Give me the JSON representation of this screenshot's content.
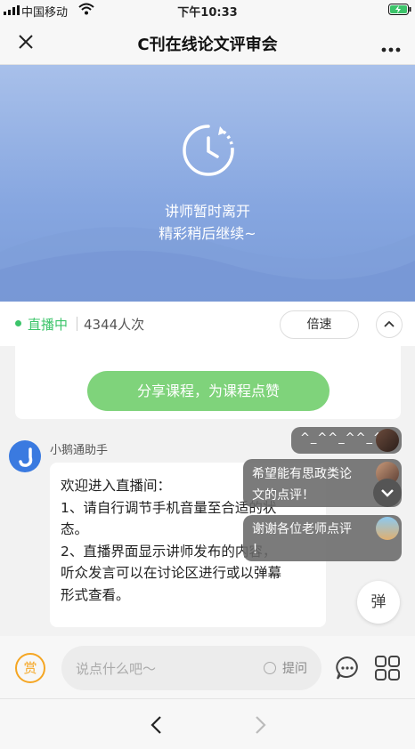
{
  "status_bar": {
    "carrier": "中国移动",
    "time": "下午10:33"
  },
  "nav": {
    "title": "C刊在线论文评审会"
  },
  "banner": {
    "line1": "讲师暂时离开",
    "line2": "精彩稍后继续~"
  },
  "live": {
    "status": "直播中",
    "viewers": "4344人次",
    "speed_label": "倍速"
  },
  "share_button": "分享课程，为课程点赞",
  "message": {
    "sender": "小鹅通助手",
    "lines": [
      "欢迎进入直播间：",
      "1、请自行调节手机音量至合适的状",
      "态。",
      "2、直播界面显示讲师发布的内容，",
      "听众发言可以在讨论区进行或以弹幕",
      "形式查看。"
    ]
  },
  "danmaku": [
    {
      "text": "^_^^_^^_^"
    },
    {
      "line1": "希望能有思政类论",
      "line2": "文的点评！"
    },
    {
      "line1": "谢谢各位老师点评",
      "line2": "！"
    }
  ],
  "danmaku_toggle": "弹",
  "input": {
    "reward": "赏",
    "placeholder": "说点什么吧～",
    "question_label": "提问"
  },
  "colors": {
    "live_green": "#3cc46a",
    "share_green": "#7fd37b",
    "reward_orange": "#f5a623",
    "banner_blue": "#86a6e0"
  }
}
